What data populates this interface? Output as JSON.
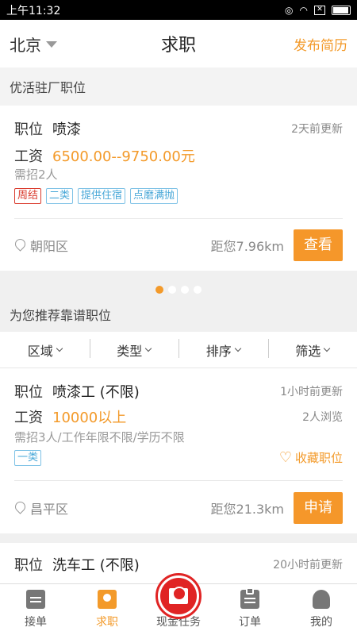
{
  "status_bar": {
    "time": "上午11:32",
    "battery_label": ""
  },
  "header": {
    "city": "北京",
    "title": "求职",
    "publish": "发布简历"
  },
  "featured": {
    "section_title": "优活驻厂职位",
    "job": {
      "position_label": "职位",
      "position": "喷漆",
      "updated": "2天前更新",
      "salary_label": "工资",
      "salary": "6500.00--9750.00元",
      "recruit": "需招2人",
      "tags": [
        {
          "text": "周结",
          "style": "red"
        },
        {
          "text": "二类",
          "style": "blue"
        },
        {
          "text": "提供住宿",
          "style": "blue"
        },
        {
          "text": "点磨满抛",
          "style": "blue"
        }
      ],
      "district": "朝阳区",
      "distance": "距您7.96km",
      "action": "查看"
    },
    "carousel": {
      "count": 4,
      "active": 0
    }
  },
  "recommended": {
    "section_title": "为您推荐靠谱职位",
    "filters": [
      "区域",
      "类型",
      "排序",
      "筛选"
    ],
    "jobs": [
      {
        "position_label": "职位",
        "position": "喷漆工 (不限)",
        "updated": "1小时前更新",
        "salary_label": "工资",
        "salary": "10000以上",
        "views": "2人浏览",
        "requirements": "需招3人/工作年限不限/学历不限",
        "tag": "一类",
        "favorite": "收藏职位",
        "district": "昌平区",
        "distance": "距您21.3km",
        "action": "申请"
      },
      {
        "position_label": "职位",
        "position": "洗车工 (不限)",
        "updated": "20小时前更新"
      }
    ]
  },
  "tabbar": {
    "tabs": [
      {
        "label": "接单",
        "icon": "order-receive-icon",
        "active": false
      },
      {
        "label": "求职",
        "icon": "job-search-icon",
        "active": true
      },
      {
        "label": "现金任务",
        "icon": "red-envelope-icon",
        "active": false
      },
      {
        "label": "订单",
        "icon": "clipboard-icon",
        "active": false
      },
      {
        "label": "我的",
        "icon": "profile-icon",
        "active": false
      }
    ]
  },
  "colors": {
    "accent": "#f39a2a",
    "cash_red": "#e02424",
    "tag_blue": "#4aa8d8",
    "tag_red": "#d9392b"
  }
}
